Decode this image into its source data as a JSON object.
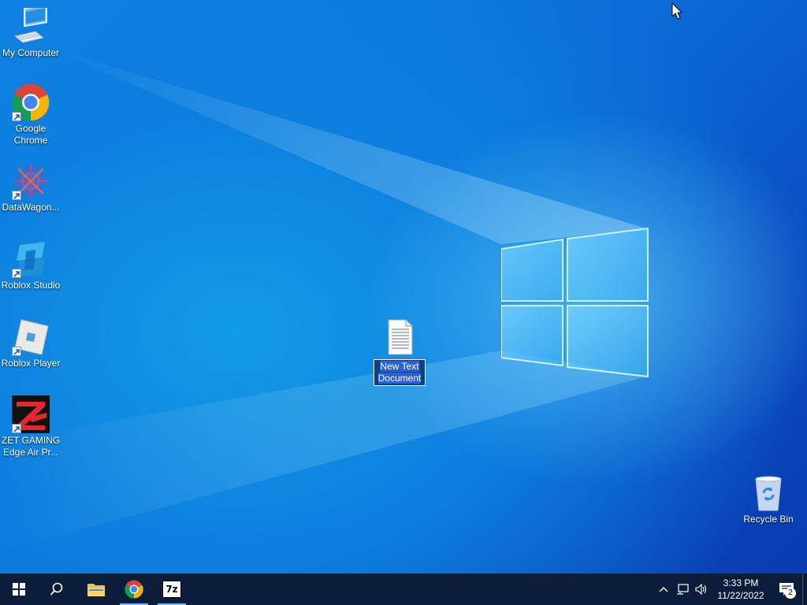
{
  "desktop": {
    "icons": [
      {
        "name": "my-computer",
        "label": "My Computer",
        "icon": "computer-icon"
      },
      {
        "name": "google-chrome",
        "label": "Google Chrome",
        "icon": "chrome-icon"
      },
      {
        "name": "datawagon",
        "label": "DataWagon...",
        "icon": "datawagon-icon"
      },
      {
        "name": "roblox-studio",
        "label": "Roblox Studio",
        "icon": "roblox-studio-icon"
      },
      {
        "name": "roblox-player",
        "label": "Roblox Player",
        "icon": "roblox-player-icon"
      },
      {
        "name": "zet-gaming",
        "label": "ZET GAMING Edge Air Pr...",
        "icon": "zet-gaming-icon"
      }
    ],
    "new_file": {
      "label": "New Text Document",
      "icon": "text-document-icon"
    },
    "recycle_bin": {
      "label": "Recycle Bin",
      "icon": "recycle-bin-icon"
    }
  },
  "taskbar": {
    "start_icon": "windows-start-icon",
    "search_icon": "search-icon",
    "pinned": [
      {
        "name": "file-explorer",
        "icon": "folder-icon"
      },
      {
        "name": "chrome",
        "icon": "chrome-icon"
      },
      {
        "name": "7zip",
        "icon": "7zip-icon",
        "text": "7z"
      }
    ],
    "tray": {
      "time": "3:33 PM",
      "date": "11/22/2022",
      "notification_count": "2"
    }
  },
  "colors": {
    "taskbar": "#0b1d3a",
    "selection": "#2a5fd6",
    "running_indicator": "#76b9ed"
  }
}
